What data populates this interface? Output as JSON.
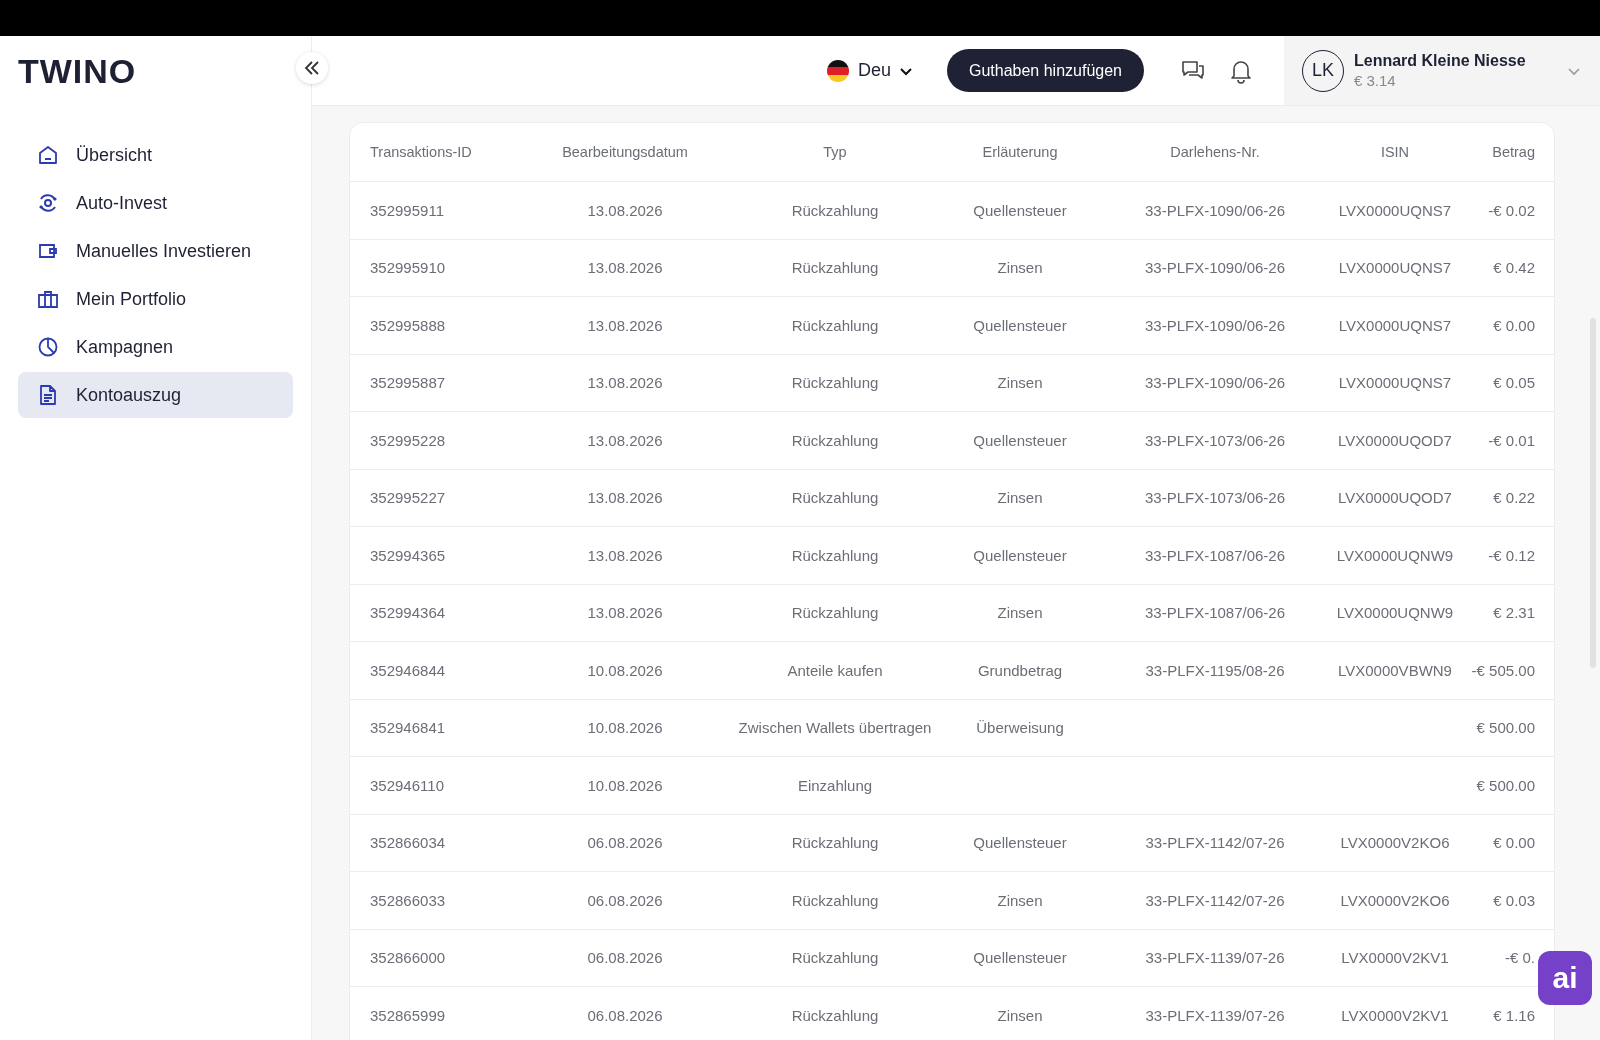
{
  "logo": "TWINO",
  "sidebar": {
    "items": [
      {
        "label": "Übersicht",
        "selected": false
      },
      {
        "label": "Auto-Invest",
        "selected": false
      },
      {
        "label": "Manuelles Investieren",
        "selected": false
      },
      {
        "label": "Mein Portfolio",
        "selected": false
      },
      {
        "label": "Kampagnen",
        "selected": false
      },
      {
        "label": "Kontoauszug",
        "selected": true
      }
    ]
  },
  "header": {
    "language": "Deu",
    "add_funds_button": "Guthaben hinzufügen",
    "user": {
      "initials": "LK",
      "name": "Lennard Kleine Niesse",
      "balance": "€ 3.14"
    }
  },
  "table": {
    "columns": [
      "Transaktions-ID",
      "Bearbeitungsdatum",
      "Typ",
      "Erläuterung",
      "Darlehens-Nr.",
      "ISIN",
      "Betrag"
    ],
    "rows": [
      {
        "id": "352995911",
        "date": "13.08.2026",
        "type": "Rückzahlung",
        "explanation": "Quellensteuer",
        "loan": "33-PLFX-1090/06-26",
        "isin": "LVX0000UQNS7",
        "amount": "-€ 0.02"
      },
      {
        "id": "352995910",
        "date": "13.08.2026",
        "type": "Rückzahlung",
        "explanation": "Zinsen",
        "loan": "33-PLFX-1090/06-26",
        "isin": "LVX0000UQNS7",
        "amount": "€ 0.42"
      },
      {
        "id": "352995888",
        "date": "13.08.2026",
        "type": "Rückzahlung",
        "explanation": "Quellensteuer",
        "loan": "33-PLFX-1090/06-26",
        "isin": "LVX0000UQNS7",
        "amount": "€ 0.00"
      },
      {
        "id": "352995887",
        "date": "13.08.2026",
        "type": "Rückzahlung",
        "explanation": "Zinsen",
        "loan": "33-PLFX-1090/06-26",
        "isin": "LVX0000UQNS7",
        "amount": "€ 0.05"
      },
      {
        "id": "352995228",
        "date": "13.08.2026",
        "type": "Rückzahlung",
        "explanation": "Quellensteuer",
        "loan": "33-PLFX-1073/06-26",
        "isin": "LVX0000UQOD7",
        "amount": "-€ 0.01"
      },
      {
        "id": "352995227",
        "date": "13.08.2026",
        "type": "Rückzahlung",
        "explanation": "Zinsen",
        "loan": "33-PLFX-1073/06-26",
        "isin": "LVX0000UQOD7",
        "amount": "€ 0.22"
      },
      {
        "id": "352994365",
        "date": "13.08.2026",
        "type": "Rückzahlung",
        "explanation": "Quellensteuer",
        "loan": "33-PLFX-1087/06-26",
        "isin": "LVX0000UQNW9",
        "amount": "-€ 0.12"
      },
      {
        "id": "352994364",
        "date": "13.08.2026",
        "type": "Rückzahlung",
        "explanation": "Zinsen",
        "loan": "33-PLFX-1087/06-26",
        "isin": "LVX0000UQNW9",
        "amount": "€ 2.31"
      },
      {
        "id": "352946844",
        "date": "10.08.2026",
        "type": "Anteile kaufen",
        "explanation": "Grundbetrag",
        "loan": "33-PLFX-1195/08-26",
        "isin": "LVX0000VBWN9",
        "amount": "-€ 505.00"
      },
      {
        "id": "352946841",
        "date": "10.08.2026",
        "type": "Zwischen Wallets übertragen",
        "explanation": "Überweisung",
        "amount": "€ 500.00"
      },
      {
        "id": "352946110",
        "date": "10.08.2026",
        "type": "Einzahlung",
        "amount": "€ 500.00"
      },
      {
        "id": "352866034",
        "date": "06.08.2026",
        "type": "Rückzahlung",
        "explanation": "Quellensteuer",
        "loan": "33-PLFX-1142/07-26",
        "isin": "LVX0000V2KO6",
        "amount": "€ 0.00"
      },
      {
        "id": "352866033",
        "date": "06.08.2026",
        "type": "Rückzahlung",
        "explanation": "Zinsen",
        "loan": "33-PLFX-1142/07-26",
        "isin": "LVX0000V2KO6",
        "amount": "€ 0.03"
      },
      {
        "id": "352866000",
        "date": "06.08.2026",
        "type": "Rückzahlung",
        "explanation": "Quellensteuer",
        "loan": "33-PLFX-1139/07-26",
        "isin": "LVX0000V2KV1",
        "amount": "-€ 0."
      },
      {
        "id": "352865999",
        "date": "06.08.2026",
        "type": "Rückzahlung",
        "explanation": "Zinsen",
        "loan": "33-PLFX-1139/07-26",
        "isin": "LVX0000V2KV1",
        "amount": "€ 1.16"
      }
    ]
  },
  "assistant_button": "ai"
}
